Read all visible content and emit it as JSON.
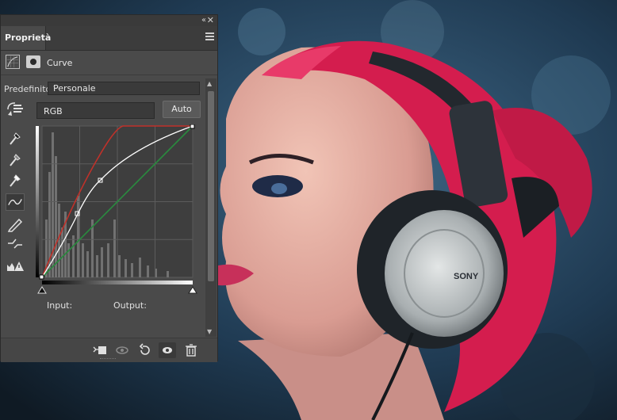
{
  "panel": {
    "collapse_glyph": "‹‹",
    "close_glyph": "✕",
    "tab_label": "Proprietà",
    "adjustment_title": "Curve",
    "preset_label": "Predefinito:",
    "preset_value": "Personale",
    "channel_value": "RGB",
    "auto_label": "Auto",
    "input_label": "Input:",
    "output_label": "Output:"
  },
  "tools": [
    "target-adjust-icon",
    "black-point-eyedropper-icon",
    "gray-point-eyedropper-icon",
    "white-point-eyedropper-icon",
    "curve-points-icon",
    "pencil-icon",
    "smooth-icon",
    "clipping-warning-icon"
  ],
  "bottom_icons": [
    "clip-to-layer-icon",
    "view-previous-icon",
    "reset-icon",
    "visibility-icon",
    "delete-icon"
  ],
  "photo": {
    "headphone_brand": "SONY",
    "colors": {
      "hair": "#d41d4e",
      "background": "#1e3348",
      "skin": "#e9b8a9",
      "headphone": "#2a2f36"
    }
  },
  "curves": {
    "colors": {
      "rgb": "#ffffff",
      "red": "#c0312a",
      "green": "#2a8a3a",
      "blue": "#3b5fb0"
    }
  }
}
